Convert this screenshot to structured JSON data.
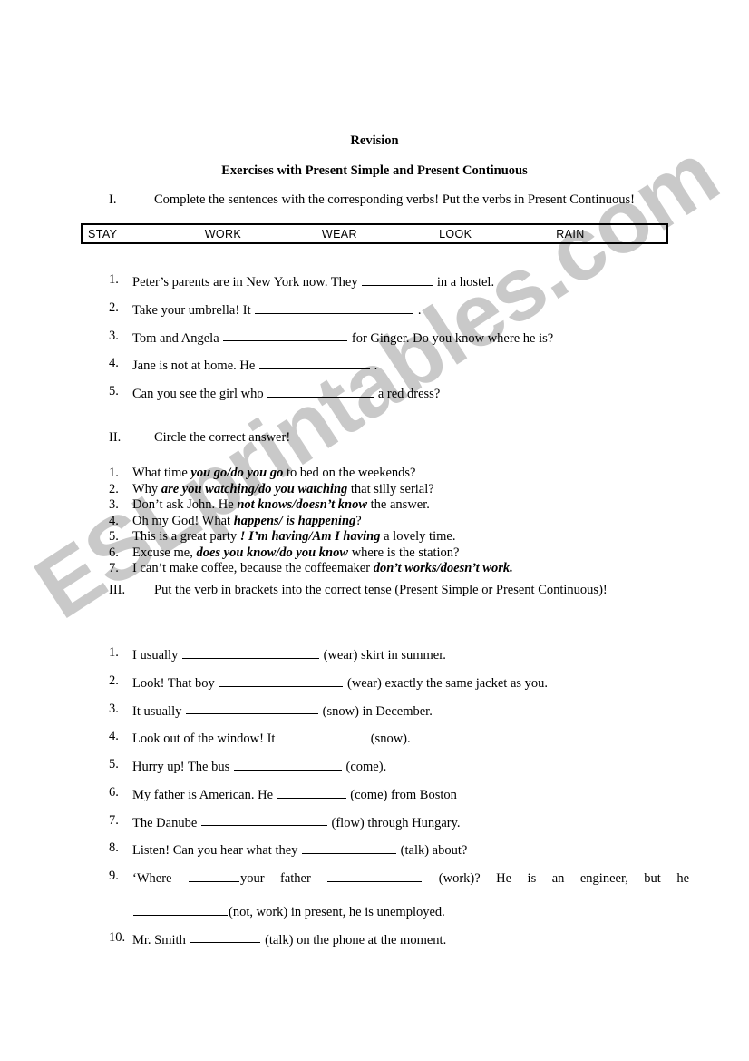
{
  "document": {
    "title": "Revision",
    "subtitle": "Exercises with Present Simple and Present Continuous",
    "watermark": "ESLprintables.com",
    "watermark_color": "#c9c9c9"
  },
  "section_1": {
    "numeral": "I.",
    "instruction": "Complete the sentences with the corresponding verbs! Put the verbs in Present Continuous!",
    "word_bank": [
      "STAY",
      "WORK",
      "WEAR",
      "LOOK",
      "RAIN"
    ],
    "items": [
      {
        "num": "1.",
        "before": "Peter’s parents are in New York now. They",
        "blank_width": 78,
        "after": "in a hostel."
      },
      {
        "num": "2.",
        "before": "Take your umbrella! It",
        "blank_width": 175,
        "after": "."
      },
      {
        "num": "3.",
        "before": "Tom and Angela",
        "blank_width": 137,
        "after": "for Ginger. Do you know where he is?"
      },
      {
        "num": "4.",
        "before": "Jane is not at home. He",
        "blank_width": 122,
        "after": "."
      },
      {
        "num": "5.",
        "before": "Can you see the girl who",
        "blank_width": 117,
        "after": "a red dress?"
      }
    ]
  },
  "section_2": {
    "numeral": "II.",
    "instruction": "Circle the correct answer!",
    "items": [
      {
        "num": "1.",
        "before": "What time",
        "choice": "you go/do you go",
        "after": "to bed on the weekends?"
      },
      {
        "num": "2.",
        "before": "Why",
        "choice": "are you watching/do you watching",
        "after": "that silly serial?"
      },
      {
        "num": "3.",
        "before": "Don’t ask John. He",
        "choice": "not knows/doesn’t know",
        "after": "the answer."
      },
      {
        "num": "4.",
        "before": "Oh my God! What",
        "choice": "happens/ is happening",
        "after": "?"
      },
      {
        "num": "5.",
        "before": "This is a great party",
        "choice": "! I’m having/Am I having",
        "after": "a lovely time."
      },
      {
        "num": "6.",
        "before": "Excuse me,",
        "choice": "does you know/do you know",
        "after": "where is the station?"
      },
      {
        "num": "7.",
        "before": "I can’t make coffee, because the coffeemaker",
        "choice": "don’t works/doesn’t work.",
        "after": ""
      }
    ]
  },
  "section_3": {
    "numeral": "III.",
    "instruction": "Put the verb in brackets into the correct tense (Present Simple or Present Continuous)!",
    "items": [
      {
        "num": "1.",
        "before": "I usually",
        "blank_width": 151,
        "after": "(wear) skirt in summer."
      },
      {
        "num": "2.",
        "before": "Look! That boy",
        "blank_width": 137,
        "after": "(wear) exactly the same jacket as you."
      },
      {
        "num": "3.",
        "before": "It usually",
        "blank_width": 146,
        "after": "(snow) in December."
      },
      {
        "num": "4.",
        "before": "Look out of the window! It",
        "blank_width": 96,
        "after": "(snow)."
      },
      {
        "num": "5.",
        "before": "Hurry up! The bus",
        "blank_width": 119,
        "after": "(come)."
      },
      {
        "num": "6.",
        "before": "My father is American. He",
        "blank_width": 76,
        "after": "(come) from Boston"
      },
      {
        "num": "7.",
        "before": "The Danube",
        "blank_width": 139,
        "after": "(flow) through Hungary."
      },
      {
        "num": "8.",
        "before": "Listen! Can you hear what they",
        "blank_width": 104,
        "after": "(talk) about?"
      },
      {
        "num": "10.",
        "before": "Mr. Smith",
        "blank_width": 78,
        "after": "(talk) on the phone at the moment."
      }
    ],
    "item_9": {
      "num": "9.",
      "line1_before": "‘Where",
      "line1_blank1_width": 56,
      "line1_mid": "your father",
      "line1_blank2_width": 104,
      "line1_after": "(work)?   He    is    an    engineer,    but    he",
      "line2_blank_width": 104,
      "line2_after": "(not, work) in present, he is unemployed."
    }
  }
}
